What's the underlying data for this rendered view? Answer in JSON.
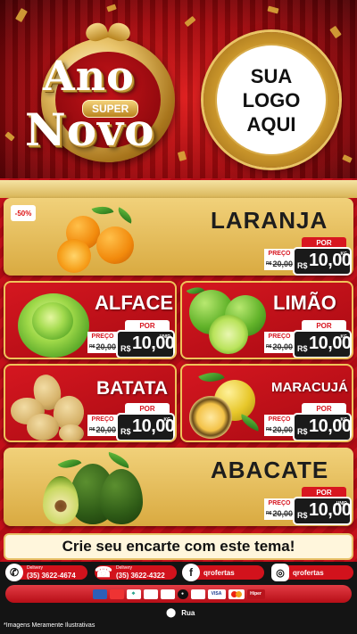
{
  "hero": {
    "emblem": {
      "line1": "Ano",
      "badge": "SUPER",
      "line2": "Novo"
    },
    "logo_text": "SUA\nLOGO\nAQUI"
  },
  "products": [
    {
      "name": "LARANJA",
      "discount": "-50%",
      "price_label": "PREÇO",
      "por_label": "POR",
      "old_prefix": "R$",
      "old_price": "20,00",
      "currency": "R$",
      "new_price": "10,00",
      "unit": "KG"
    },
    {
      "name": "ALFACE",
      "price_label": "PREÇO",
      "por_label": "POR",
      "old_prefix": "R$",
      "old_price": "20,00",
      "currency": "R$",
      "new_price": "10,00",
      "unit": "UNID"
    },
    {
      "name": "LIMÃO",
      "price_label": "PREÇO",
      "por_label": "POR",
      "old_prefix": "R$",
      "old_price": "20,00",
      "currency": "R$",
      "new_price": "10,00",
      "unit": "KG"
    },
    {
      "name": "BATATA",
      "price_label": "PREÇO",
      "por_label": "POR",
      "old_prefix": "R$",
      "old_price": "20,00",
      "currency": "R$",
      "new_price": "10,00",
      "unit": "KG"
    },
    {
      "name": "MARACUJÁ",
      "price_label": "PREÇO",
      "por_label": "POR",
      "old_prefix": "R$",
      "old_price": "20,00",
      "currency": "R$",
      "new_price": "10,00",
      "unit": "KG"
    },
    {
      "name": "ABACATE",
      "price_label": "PREÇO",
      "por_label": "POR",
      "old_prefix": "R$",
      "old_price": "20,00",
      "currency": "R$",
      "new_price": "10,00",
      "unit": "UNID"
    }
  ],
  "banner": "Crie seu encarte com este tema!",
  "contacts": [
    {
      "icon": "whatsapp-icon",
      "label": "Delivery",
      "value": "(35) 3622-4674"
    },
    {
      "icon": "phone-icon",
      "label": "Delivery",
      "value": "(35) 3622-4322"
    },
    {
      "icon": "facebook-icon",
      "value": "qrofertas"
    },
    {
      "icon": "instagram-icon",
      "value": "qrofertas"
    }
  ],
  "payment_methods": [
    "card",
    "card",
    "pix",
    "ticket",
    "card",
    "elo",
    "card",
    "VISA",
    "Master",
    "Hiper"
  ],
  "address": "Rua",
  "disclaimer": "*Imagens Meramente Ilustrativas",
  "colors": {
    "red": "#c3101a",
    "gold": "#e3bb55",
    "dark": "#141414"
  }
}
